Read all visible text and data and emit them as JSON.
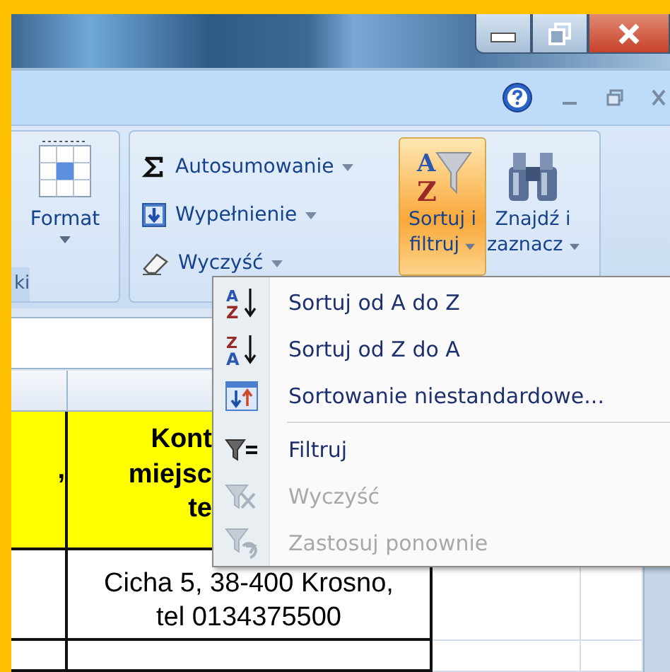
{
  "ribbon": {
    "format_button": {
      "label": "Format"
    },
    "group_label": "ki",
    "edit_commands": [
      {
        "label": "Autosumowanie",
        "kind": "sum"
      },
      {
        "label": "Wypełnienie",
        "kind": "fill"
      },
      {
        "label": "Wyczyść",
        "kind": "clear"
      }
    ],
    "large_buttons": [
      {
        "line1": "Sortuj i",
        "line2": "filtruj",
        "kind": "sort",
        "icon_text": [
          "A",
          "Z"
        ],
        "open": true
      },
      {
        "line1": "Znajdź i",
        "line2": "zaznacz",
        "kind": "find",
        "open": false
      }
    ]
  },
  "sheet": {
    "rows": [
      {
        "kind": "header",
        "column_1": ",",
        "column_2": "Kont\nmiejsc\nte"
      },
      {
        "kind": "data",
        "column_2": "Cicha 5, 38-400 Krosno,\ntel 0134375500"
      }
    ]
  },
  "menu": {
    "items": [
      {
        "kind": "sort-asc",
        "label": "Sortuj od A do Z",
        "icon_text": [
          "A",
          "Z"
        ],
        "disabled": false
      },
      {
        "kind": "sort-desc",
        "label": "Sortuj od Z do A",
        "icon_text": [
          "Z",
          "A"
        ],
        "disabled": false
      },
      {
        "kind": "custom-sort",
        "label": "Sortowanie niestandardowe...",
        "disabled": false
      },
      {
        "kind": "separator"
      },
      {
        "kind": "filter",
        "label": "Filtruj",
        "disabled": false
      },
      {
        "kind": "clear-filter",
        "label": "Wyczyść",
        "disabled": true
      },
      {
        "kind": "reapply",
        "label": "Zastosuj ponownie",
        "disabled": true
      }
    ]
  }
}
